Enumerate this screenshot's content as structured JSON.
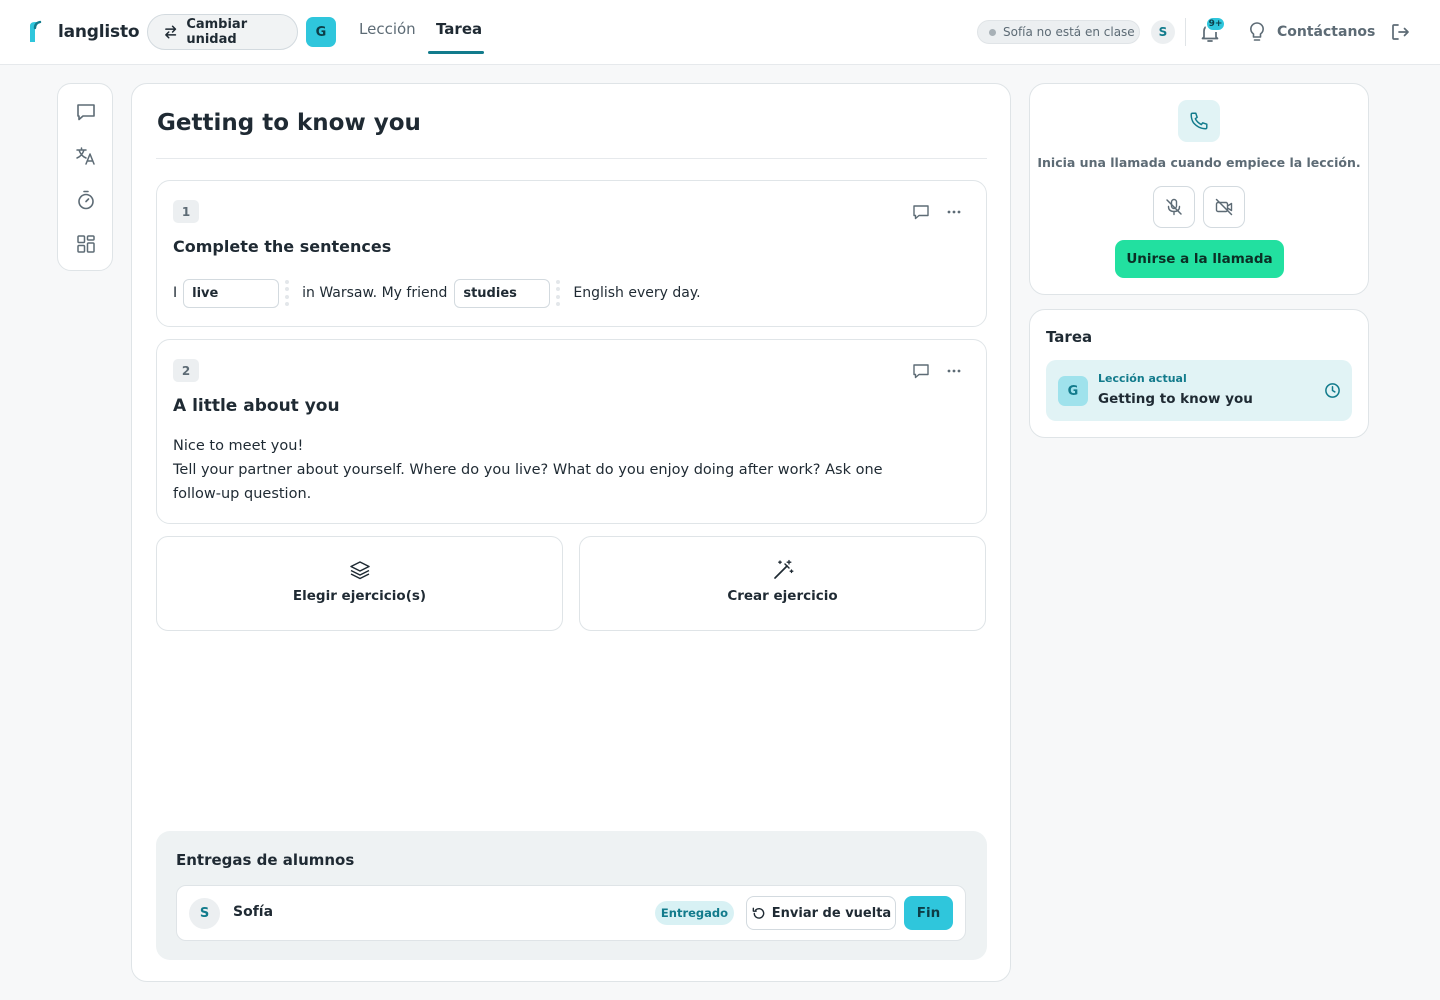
{
  "header": {
    "brand": "langlisto",
    "switch_unit_label": "Cambiar unidad",
    "unit_initial": "G",
    "tabs": [
      {
        "label": "Lección",
        "active": false
      },
      {
        "label": "Tarea",
        "active": true
      }
    ],
    "student_status": "Sofía no está en clase",
    "student_initial": "S",
    "notifications_badge": "9+",
    "contact_label": "Contáctanos",
    "accent_color": "#127b8c",
    "brand_color": "#2fc6dc"
  },
  "toolbar": {
    "icons": [
      "chat-icon",
      "translate-icon",
      "timer-icon",
      "grid-icon"
    ]
  },
  "main": {
    "title": "Getting to know you",
    "exercises": [
      {
        "number": "1",
        "title": "Complete the sentences",
        "sentence": {
          "part1": "I",
          "blank1": "live",
          "part2": "in Warsaw. My friend",
          "blank2": "studies",
          "part3": "English every day."
        }
      },
      {
        "number": "2",
        "title": "A little about you",
        "line1": "Nice to meet you!",
        "line2": "Tell your partner about yourself. Where do you live? What do you enjoy doing after work? Ask one follow-up question."
      }
    ],
    "actions": {
      "choose_label": "Elegir ejercicio(s)",
      "create_label": "Crear ejercicio"
    },
    "submissions": {
      "title": "Entregas de alumnos",
      "rows": [
        {
          "initial": "S",
          "name": "Sofía",
          "status": "Entregado",
          "return_label": "Enviar de vuelta",
          "done_label": "Fin"
        }
      ]
    }
  },
  "call": {
    "text": "Inicia una llamada cuando empiece la lección.",
    "join_label": "Unirse a la llamada",
    "join_color": "#22e0a0"
  },
  "tarea_panel": {
    "title": "Tarea",
    "current_kicker": "Lección actual",
    "current_name": "Getting to know you",
    "current_initial": "G"
  }
}
